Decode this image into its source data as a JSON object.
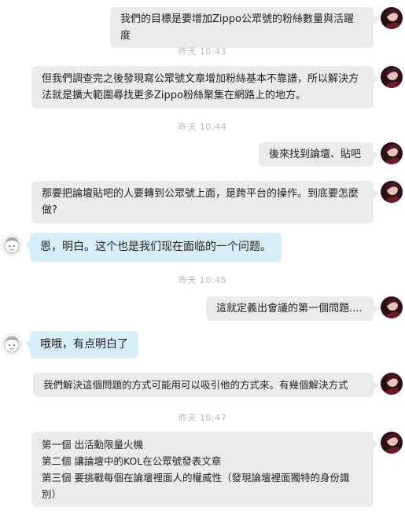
{
  "messages": [
    {
      "id": "m1",
      "text": "我們的目標是要增加Zippo公眾號的粉絲數量與活躍度"
    },
    {
      "id": "m2",
      "text": "但我們調查完之後發現寫公眾號文章增加粉絲基本不靠譜，所以解決方法就是擴大範圍尋找更多Zippo粉絲聚集在網路上的地方。"
    },
    {
      "id": "m3",
      "text": "後來找到論壇、貼吧"
    },
    {
      "id": "m4",
      "text": "那要把論壇貼吧的人要轉到公眾號上面，是跨平台的操作。到底要怎麼做?"
    },
    {
      "id": "m5",
      "text": "恩，明白。这个也是我们现在面临的一个问题。"
    },
    {
      "id": "m6",
      "text": "這就定義出會議的第一個問題...."
    },
    {
      "id": "m7",
      "text": "哦哦，有点明白了"
    },
    {
      "id": "m8",
      "text": "我們解決這個問題的方式可能用可以吸引他的方式來。有幾個解決方式"
    },
    {
      "id": "m9",
      "lines": [
        "第一個  出活動限量火機",
        "第二個  讓論壇中的KOL在公眾號發表文章",
        "第三個  要挑戰每個在論壇裡面人的權威性（發現論壇裡面獨特的身份識別）"
      ]
    }
  ],
  "timestamps": [
    "昨天 10:43",
    "昨天 10:44",
    "昨天 10:45",
    "昨天 10:47"
  ],
  "avatars": {
    "self": "dark-portrait-avatar-icon",
    "other": "sketch-face-avatar-icon"
  }
}
